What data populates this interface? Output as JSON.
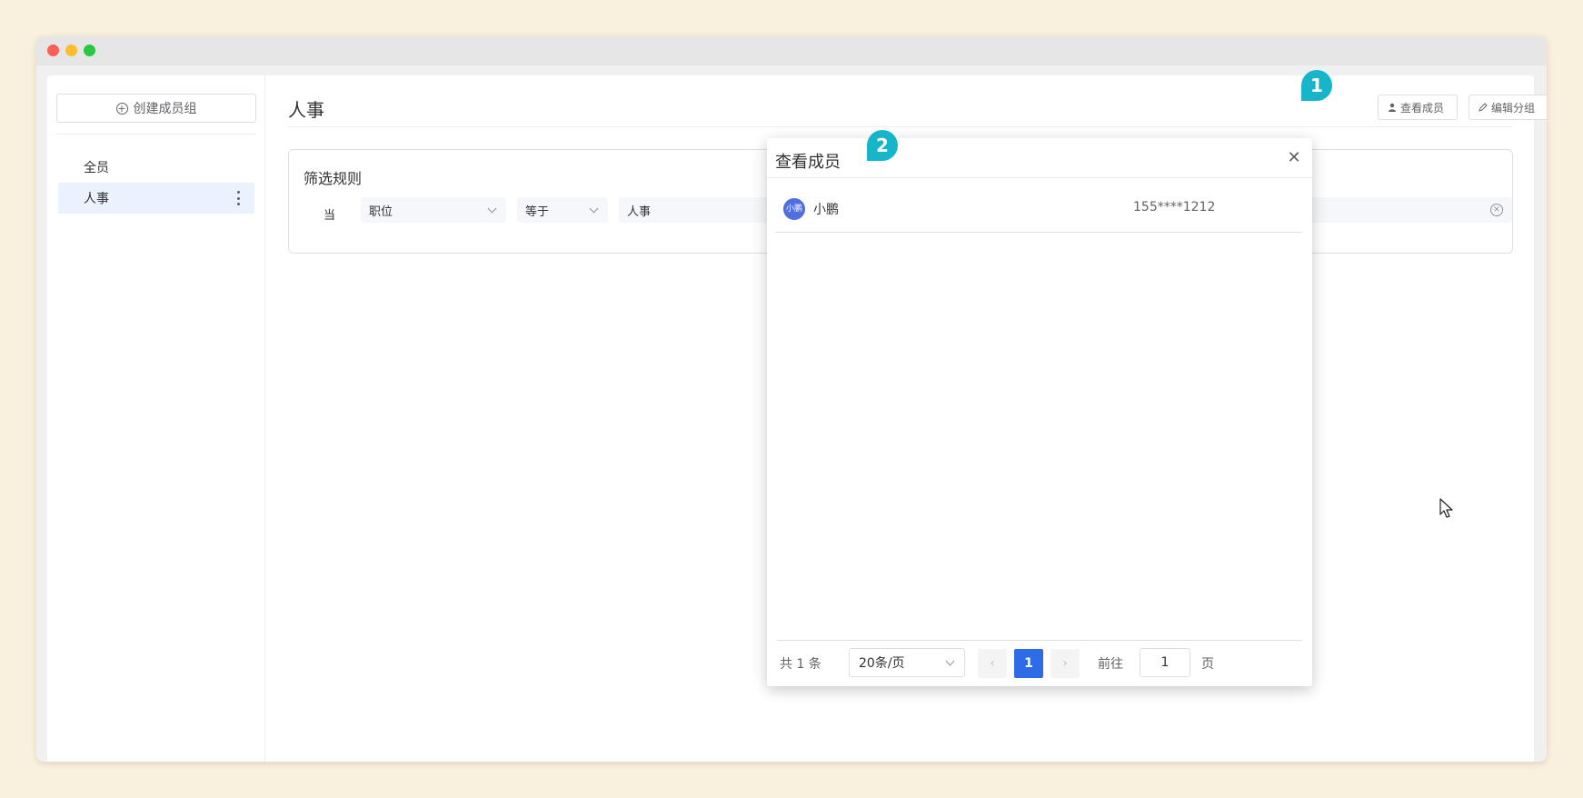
{
  "sidebar": {
    "create_label": "创建成员组",
    "items": [
      {
        "label": "全员"
      },
      {
        "label": "人事"
      }
    ]
  },
  "header": {
    "title": "人事",
    "view_members": "查看成员",
    "edit_group": "编辑分组"
  },
  "filter": {
    "title": "筛选规则",
    "when": "当",
    "field": "职位",
    "operator": "等于",
    "value": "人事"
  },
  "dialog": {
    "title": "查看成员",
    "members": [
      {
        "avatar": "小鹏",
        "name": "小鹏",
        "phone": "155****1212"
      }
    ],
    "pagination": {
      "total": "共 1 条",
      "page_size": "20条/页",
      "current": "1",
      "goto_label": "前往",
      "goto_value": "1",
      "page_label": "页"
    }
  },
  "annotations": {
    "badge1": "1",
    "badge2": "2"
  },
  "colors": {
    "accent": "#2e6be6",
    "badge": "#17b5c9",
    "sidebar_active": "#ebf2fd"
  }
}
